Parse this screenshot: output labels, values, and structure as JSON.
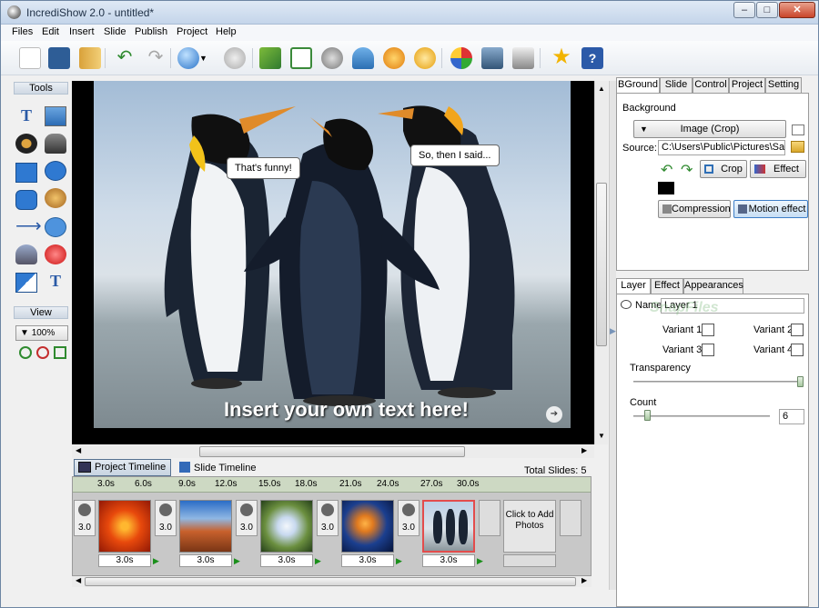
{
  "window": {
    "title": "IncrediShow 2.0 - untitled*"
  },
  "menu": [
    "Files",
    "Edit",
    "Insert",
    "Slide",
    "Publish",
    "Project",
    "Help"
  ],
  "left_panel": {
    "tools_header": "Tools",
    "view_header": "View",
    "zoom": "100%"
  },
  "stage": {
    "bubble_left": "That's funny!",
    "bubble_right": "So, then I said...",
    "caption": "Insert your own text here!"
  },
  "timeline_tabs": {
    "project": "Project Timeline",
    "slide": "Slide Timeline"
  },
  "total_slides": "Total Slides: 5",
  "timeline": {
    "ticks": [
      "3.0s",
      "6.0s",
      "9.0s",
      "12.0s",
      "15.0s",
      "18.0s",
      "21.0s",
      "24.0s",
      "27.0s",
      "30.0s"
    ],
    "transition_duration": "3.0",
    "slides": [
      {
        "duration": "3.0s"
      },
      {
        "duration": "3.0s"
      },
      {
        "duration": "3.0s"
      },
      {
        "duration": "3.0s"
      },
      {
        "duration": "3.0s"
      }
    ],
    "add_photos": "Click to Add Photos"
  },
  "right_panel": {
    "top_tabs": [
      "BGround",
      "Slide",
      "Control",
      "Project",
      "Setting"
    ],
    "background_label": "Background",
    "bg_type": "Image (Crop)",
    "source_label": "Source:",
    "source_value": "C:\\Users\\Public\\Pictures\\Sample",
    "crop": "Crop",
    "effect": "Effect",
    "compression": "Compression",
    "motion_effect": "Motion effect",
    "bottom_tabs": [
      "Layer",
      "Effect",
      "Appearances"
    ],
    "name_label": "Name:",
    "name_value": "Layer 1",
    "variants": [
      "Variant 1",
      "Variant 2",
      "Variant 3",
      "Variant 4"
    ],
    "transparency_label": "Transparency",
    "count_label": "Count",
    "count_value": "6",
    "watermark": "SnapFiles"
  }
}
